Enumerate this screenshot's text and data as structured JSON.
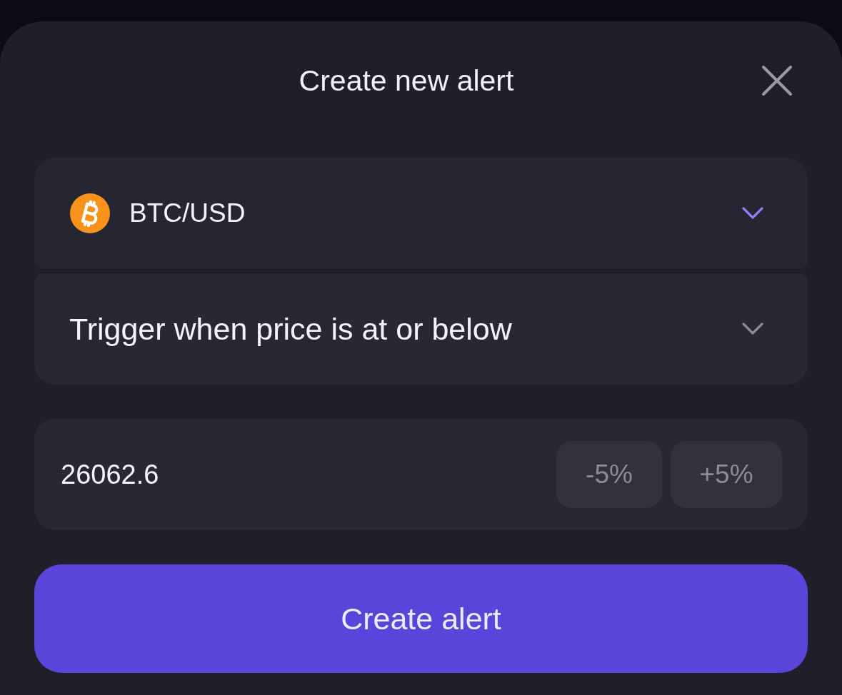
{
  "window": {
    "title": "Create new alert"
  },
  "selectors": [
    {
      "kind": "asset",
      "value": "BTC/USD"
    },
    {
      "kind": "condition",
      "value": "Trigger when price is at or below"
    }
  ],
  "price": {
    "value": "26062.6",
    "adjust_buttons": [
      "-5%",
      "+5%"
    ]
  },
  "buttons": [
    "Create alert"
  ]
}
